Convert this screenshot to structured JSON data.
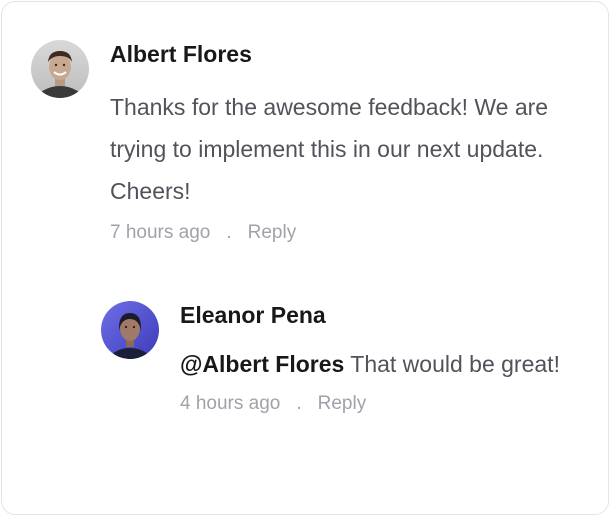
{
  "comments": [
    {
      "author": "Albert Flores",
      "text": "Thanks for the awesome feedback! We are trying to implement this in our next update. Cheers!",
      "time": "7 hours ago",
      "separator": ".",
      "reply_label": "Reply",
      "avatar": "avatar-man-smiling"
    }
  ],
  "reply": {
    "author": "Eleanor Pena",
    "mention": "@Albert Flores",
    "text": " That would be great!",
    "time": "4 hours ago",
    "separator": ".",
    "reply_label": "Reply",
    "avatar": "avatar-woman-blue-light"
  }
}
